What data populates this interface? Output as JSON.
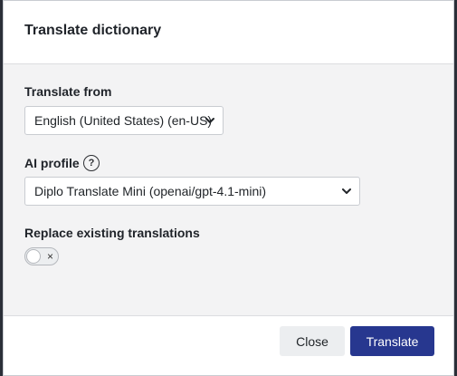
{
  "dialog": {
    "title": "Translate dictionary"
  },
  "form": {
    "translate_from": {
      "label": "Translate from",
      "selected": "English (United States) (en-US)"
    },
    "ai_profile": {
      "label": "AI profile",
      "help_symbol": "?",
      "selected": "Diplo Translate Mini (openai/gpt-4.1-mini)"
    },
    "replace_existing": {
      "label": "Replace existing translations",
      "enabled": false,
      "off_symbol": "×"
    }
  },
  "footer": {
    "close_label": "Close",
    "translate_label": "Translate"
  },
  "colors": {
    "primary": "#27378f",
    "body_bg": "#f3f3f4",
    "backdrop": "#2b2f38"
  },
  "icons": {
    "select_arrow": "chevron-down-icon",
    "help": "help-circle-icon",
    "toggle_off": "close-icon"
  }
}
